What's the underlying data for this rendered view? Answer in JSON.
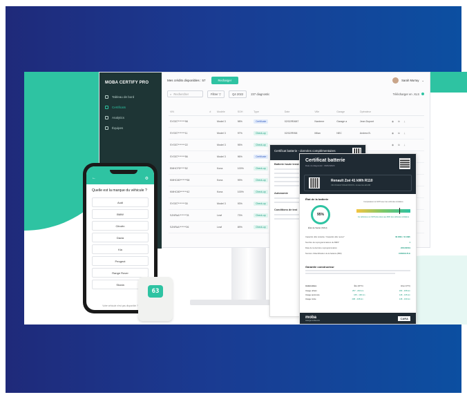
{
  "colors": {
    "accent": "#2ec3a2",
    "sidebar": "#1e3535",
    "frame": "#1a3b92"
  },
  "dashboard": {
    "brand": "MOBA CERTIFY PRO",
    "nav": [
      {
        "label": "Tableau de bord",
        "icon": "home-icon"
      },
      {
        "label": "Certificats",
        "icon": "star-icon"
      },
      {
        "label": "Analytics",
        "icon": "bar-chart-icon"
      },
      {
        "label": "Équipes",
        "icon": "users-icon"
      }
    ],
    "credits": "Mes crédits disponibles : 57",
    "recharge": "Recharger",
    "user": "Sarah Murray",
    "search_placeholder": "Rechercher",
    "filter": "Filtrer",
    "period": "Q4 2022",
    "count": "237 diagnostic",
    "download": "Télécharger en .XLS",
    "columns": [
      "VIN",
      "#",
      "Modèle",
      "SOH",
      "Type",
      "Date",
      "Ville",
      "Garage",
      "Opérateur"
    ],
    "rows": [
      {
        "vin": "SYGE7*******98",
        "model": "Model 3",
        "soh": "98%",
        "tag": "Certificate",
        "tone": "b",
        "date": "02/02/R0687",
        "city": "Nanterre",
        "garage": "Garage a",
        "op": "Jean Dupont"
      },
      {
        "vin": "SYGE7*******11",
        "model": "Model 3",
        "soh": "97%",
        "tag": "Check-up",
        "tone": "g",
        "date": "02/02/R958",
        "city": "Milan",
        "garage": "NEC",
        "op": "Andrea B."
      },
      {
        "vin": "SYGE7*******22",
        "model": "Model 3",
        "soh": "95%",
        "tag": "Check-up",
        "tone": "g",
        "date": "",
        "city": "",
        "garage": "",
        "op": ""
      },
      {
        "vin": "SYGE7*******56",
        "model": "Model 3",
        "soh": "96%",
        "tag": "Certificate",
        "tone": "b",
        "date": "",
        "city": "",
        "garage": "",
        "op": ""
      },
      {
        "vin": "EMHCF5*****52",
        "model": "Kona",
        "soh": "100%",
        "tag": "Check-up",
        "tone": "g",
        "date": "",
        "city": "",
        "garage": "",
        "op": ""
      },
      {
        "vin": "KMHC80*******58",
        "model": "Kona",
        "soh": "99%",
        "tag": "Check-up",
        "tone": "g",
        "date": "",
        "city": "",
        "garage": "",
        "op": ""
      },
      {
        "vin": "KMHC80*******42",
        "model": "Kona",
        "soh": "100%",
        "tag": "Check-up",
        "tone": "g",
        "date": "",
        "city": "",
        "garage": "",
        "op": ""
      },
      {
        "vin": "SYGE7*******30",
        "model": "Model 3",
        "soh": "93%",
        "tag": "Check-up",
        "tone": "g",
        "date": "",
        "city": "",
        "garage": "",
        "op": ""
      },
      {
        "vin": "SJNFAA*******78",
        "model": "Leaf",
        "soh": "73%",
        "tag": "Check-up",
        "tone": "g",
        "date": "",
        "city": "",
        "garage": "",
        "op": ""
      },
      {
        "vin": "SJNFAA*******26",
        "model": "Leaf",
        "soh": "89%",
        "tag": "Check-up",
        "tone": "g",
        "date": "",
        "city": "",
        "garage": "",
        "op": ""
      }
    ]
  },
  "phone": {
    "question": "Quelle est la marque du véhicule ?",
    "brands": [
      "Audi",
      "BMW",
      "Citroën",
      "Dacia",
      "Kia",
      "Peugeot",
      "Range Rover",
      "Skoda"
    ],
    "footer": "Votre véhicule n'est pas disponible ?"
  },
  "dongle": {
    "label": "63"
  },
  "cert_back": {
    "title": "Certificat batterie - données complémentaires",
    "section1": "Batterie haute tension",
    "section2": "Autonomie",
    "section3": "Conditions de test"
  },
  "cert_front": {
    "title": "Certificat batterie",
    "sub": "Date du diagnostic : 09/02/2023",
    "car": "Renault Zoé 41 kWh R110",
    "car_meta": "VIN VF1AGVYF0A2XXXXXX  •  Immat GA-123-XB",
    "state_title": "État de la batterie",
    "soh": "95%",
    "soh_label": "État de Santé (SOH)",
    "gauge_caption": "Comparaison du SOH avec des véhicules similaires",
    "gauge_note": "Ce véhicule a un SOH plus élevé que 80% des véhicules similaires",
    "gauge_value": 0.8,
    "facts": [
      {
        "k": "Capacité utile restante / Capacité utile neuve*",
        "v": "39 kWh / 41 kWh"
      },
      {
        "k": "Nombre de reprogrammations du BMS*",
        "v": "1"
      },
      {
        "k": "Date de la dernière reprogrammation",
        "v": "22/12/2019"
      },
      {
        "k": "Numéro d'identification de la batterie (BID)",
        "v": "CONSULTLE"
      }
    ],
    "warranty_title": "Garantie constructeur",
    "autonomy_title": "Autonomies",
    "autonomy_cols": [
      "Été (20°C)",
      "Hiver (0°C)"
    ],
    "autonomy_rows": [
      {
        "label": "Usage urbain",
        "summer": "257 - 294 km",
        "winter": "183 - 208 km"
      },
      {
        "label": "Usage autoroute",
        "summer": "165 - 190 km",
        "winter": "118 - 135 km"
      },
      {
        "label": "Usage mixte",
        "summer": "208 - 238 km",
        "winter": "148 - 169 km"
      }
    ],
    "footer_brand": "moba",
    "footer_url": "www.get-moba.com",
    "cara": "CARA"
  }
}
